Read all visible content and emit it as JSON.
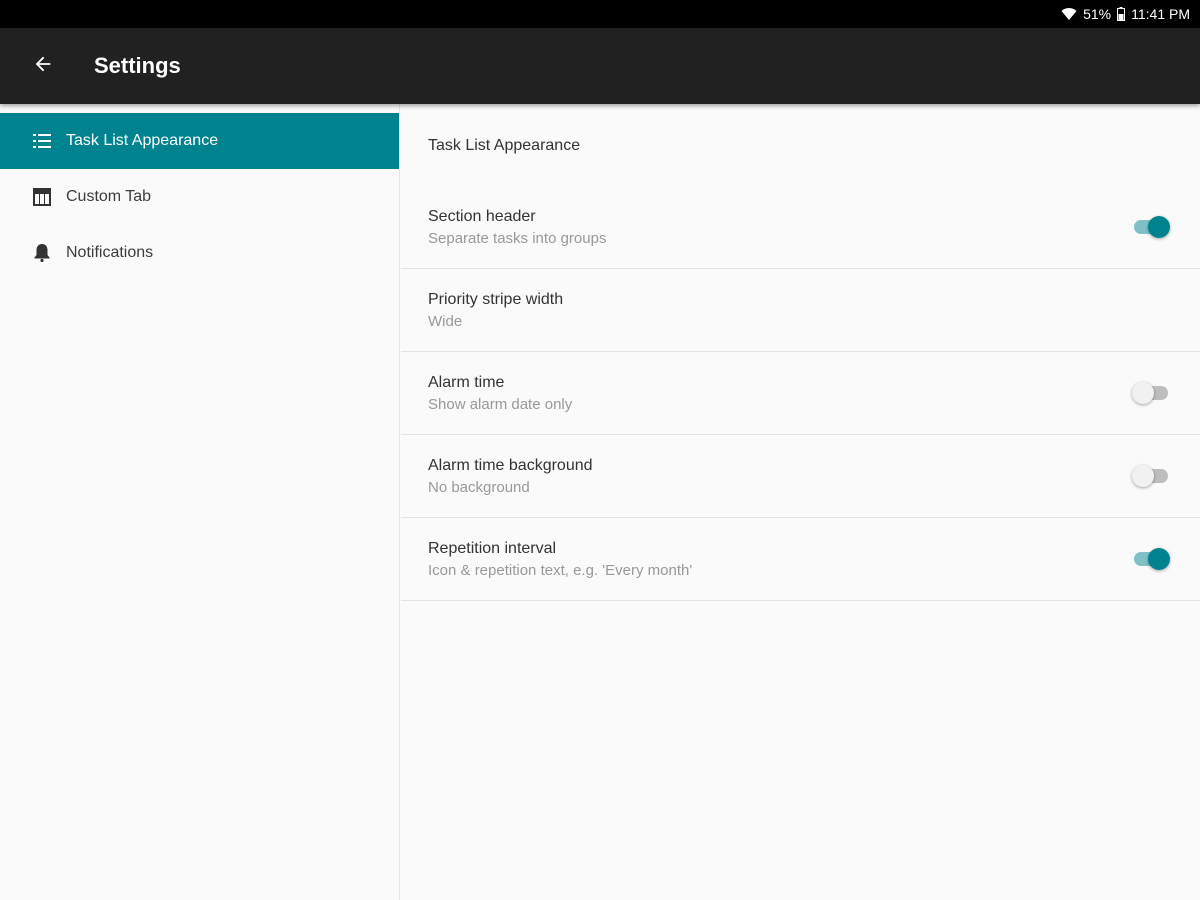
{
  "status_bar": {
    "battery": "51%",
    "time": "11:41 PM"
  },
  "app_bar": {
    "title": "Settings",
    "back_icon": "arrow-back-icon"
  },
  "sidebar": {
    "items": [
      {
        "label": "Task List Appearance",
        "icon": "list-icon",
        "active": true
      },
      {
        "label": "Custom Tab",
        "icon": "table-icon",
        "active": false
      },
      {
        "label": "Notifications",
        "icon": "bell-icon",
        "active": false
      }
    ]
  },
  "content": {
    "section_title": "Task List Appearance",
    "prefs": [
      {
        "title": "Section header",
        "summary": "Separate tasks into groups",
        "switch": true
      },
      {
        "title": "Priority stripe width",
        "summary": "Wide",
        "switch": null
      },
      {
        "title": "Alarm time",
        "summary": "Show alarm date only",
        "switch": false
      },
      {
        "title": "Alarm time background",
        "summary": "No background",
        "switch": false
      },
      {
        "title": "Repetition interval",
        "summary": "Icon & repetition text, e.g. 'Every month'",
        "switch": true
      }
    ]
  },
  "colors": {
    "accent": "#00838f",
    "app_bar": "#212121",
    "status_bar": "#000000",
    "background": "#fafafa"
  }
}
